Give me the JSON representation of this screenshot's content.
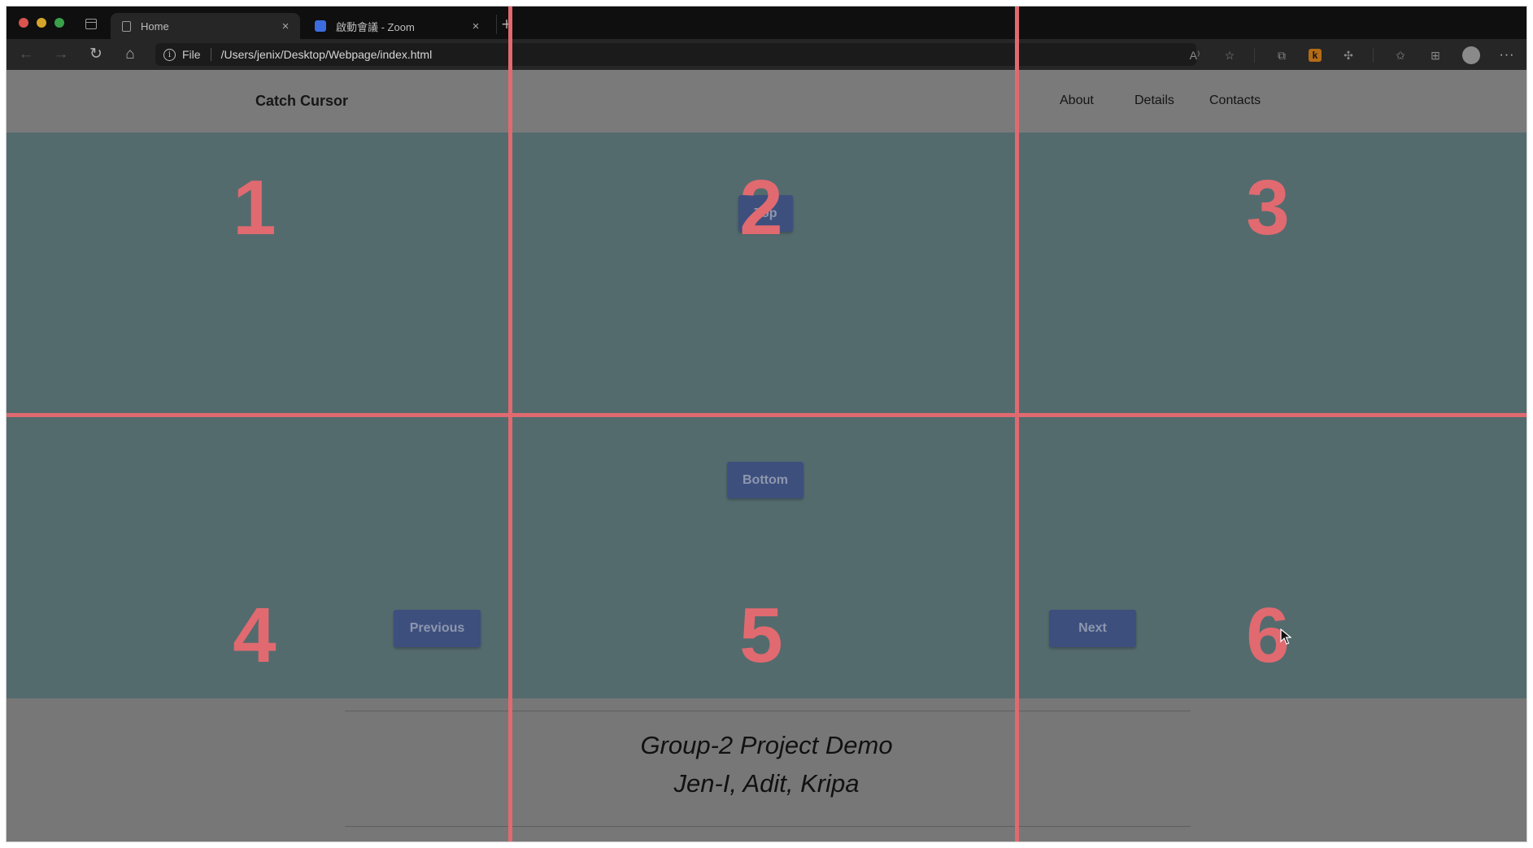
{
  "browser": {
    "tabs": [
      {
        "label": "Home",
        "icon": "page-icon"
      },
      {
        "label": "啟動會議 - Zoom",
        "icon": "zoom-icon"
      }
    ],
    "address": {
      "scheme_label": "File",
      "url": "/Users/jenix/Desktop/Webpage/index.html"
    },
    "toolbar_icons": [
      "read-aloud-icon",
      "favorite-add-icon",
      "extension-icon",
      "k-extension-icon",
      "puzzle-icon",
      "favorites-icon",
      "collections-icon",
      "profile-icon",
      "more-icon"
    ]
  },
  "header": {
    "brand": "Catch Cursor",
    "nav": [
      "About",
      "Details",
      "Contacts"
    ]
  },
  "buttons": {
    "top": "Top",
    "bottom": "Bottom",
    "previous": "Previous",
    "next": "Next"
  },
  "footer": {
    "title": "Group-2 Project Demo",
    "names": "Jen-I, Adit, Kripa"
  },
  "overlay": {
    "cells": [
      "1",
      "2",
      "3",
      "4",
      "5",
      "6"
    ],
    "color": "#e06a70"
  },
  "colors": {
    "stage": "#546b6e",
    "button": "#3d4f7d",
    "header": "#7a7a7a"
  }
}
